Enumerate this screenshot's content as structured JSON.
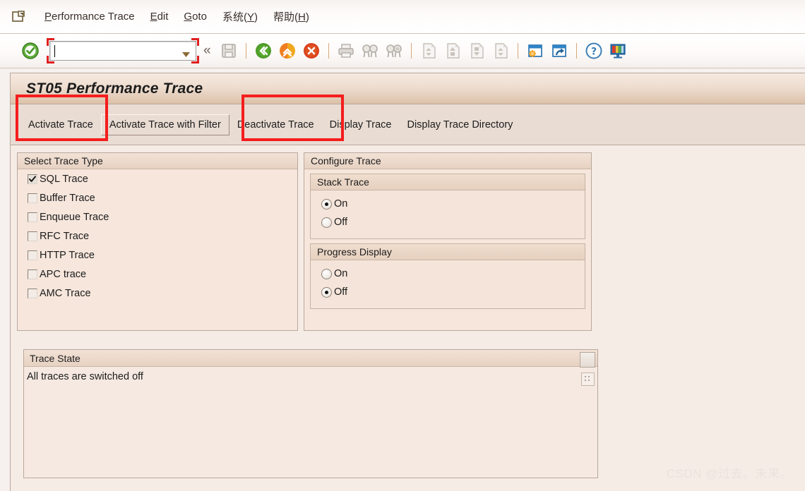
{
  "menubar": {
    "system_icon": "sap-system-menu-icon",
    "items": [
      {
        "label": "Performance Trace",
        "accel": "P",
        "accel_pos": 0
      },
      {
        "label": "Edit",
        "accel": "E",
        "accel_pos": 0
      },
      {
        "label": "Goto",
        "accel": "G",
        "accel_pos": 0
      },
      {
        "label": "系统(Y)",
        "accel": "Y",
        "accel_pos": -1
      },
      {
        "label": "帮助(H)",
        "accel": "H",
        "accel_pos": -1
      }
    ]
  },
  "toolbar": {
    "enter_icon": "green-check-enter-icon",
    "command_field": {
      "value": "",
      "placeholder": "",
      "dropdown_icon": "dropdown-arrow-icon"
    },
    "collapse_icon": "double-chevron-left-icon",
    "icons": [
      "save-icon",
      "back-green-icon",
      "exit-up-yellow-icon",
      "cancel-red-icon",
      "print-icon",
      "find-icon",
      "find-next-icon",
      "first-page-icon",
      "previous-page-icon",
      "next-page-icon",
      "last-page-icon",
      "create-session-icon",
      "create-shortcut-icon",
      "help-icon",
      "customize-local-layout-icon"
    ]
  },
  "title": "ST05 Performance Trace",
  "buttons": [
    {
      "label": "Activate Trace",
      "style": "flat",
      "highlighted": true
    },
    {
      "label": "Activate Trace with Filter",
      "style": "raised",
      "highlighted": false
    },
    {
      "label": "Deactivate Trace",
      "style": "flat",
      "highlighted": true
    },
    {
      "label": "Display Trace",
      "style": "flat",
      "highlighted": false
    },
    {
      "label": "Display Trace Directory",
      "style": "flat",
      "highlighted": false
    }
  ],
  "select_trace_type": {
    "header": "Select Trace Type",
    "options": [
      {
        "label": "SQL Trace",
        "checked": true
      },
      {
        "label": "Buffer Trace",
        "checked": false
      },
      {
        "label": "Enqueue Trace",
        "checked": false
      },
      {
        "label": "RFC Trace",
        "checked": false
      },
      {
        "label": "HTTP Trace",
        "checked": false
      },
      {
        "label": "APC trace",
        "checked": false
      },
      {
        "label": "AMC Trace",
        "checked": false
      }
    ]
  },
  "configure_trace": {
    "header": "Configure Trace",
    "stack_trace": {
      "header": "Stack Trace",
      "options": [
        {
          "label": "On",
          "selected": true
        },
        {
          "label": "Off",
          "selected": false
        }
      ]
    },
    "progress_display": {
      "header": "Progress Display",
      "options": [
        {
          "label": "On",
          "selected": false
        },
        {
          "label": "Off",
          "selected": true
        }
      ]
    }
  },
  "trace_state": {
    "header": "Trace State",
    "message": "All traces are switched off",
    "scroll_icon": "scroll-up-button",
    "grip_icon": "resize-grip-icon"
  },
  "watermark": "CSDN @过去。未来。",
  "colors": {
    "highlight": "#f51d1d",
    "title_bar_dark": "#dcc1a9",
    "panel_bg": "#f6e6dc",
    "button_row_bg": "#e9dcd3"
  }
}
